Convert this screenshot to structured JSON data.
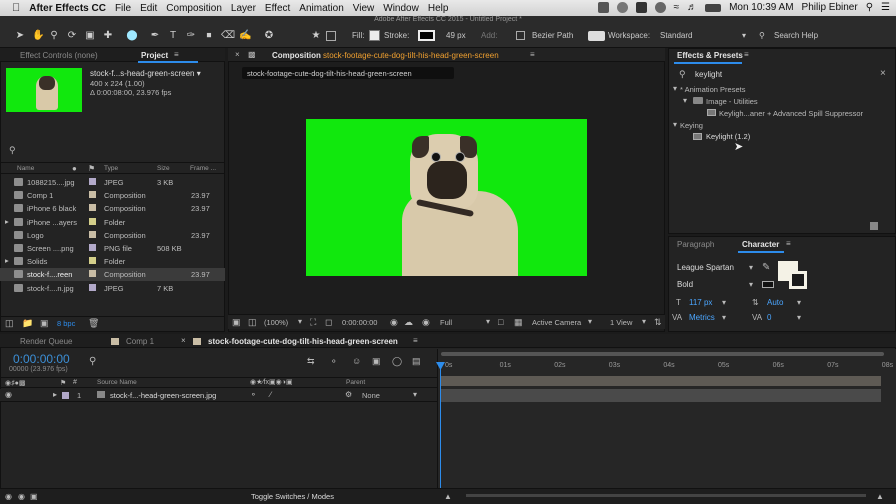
{
  "menubar": {
    "app_name": "After Effects CC",
    "items": [
      "File",
      "Edit",
      "Composition",
      "Layer",
      "Effect",
      "Animation",
      "View",
      "Window",
      "Help"
    ],
    "clock": "Mon 10:39 AM",
    "user": "Philip Ebiner"
  },
  "window_title": "Adobe After Effects CC 2015 - Untitled Project *",
  "toolbar": {
    "fill_label": "Fill:",
    "stroke_label": "Stroke:",
    "stroke_px": "49 px",
    "add_label": "Add:",
    "bezier_label": "Bezier Path",
    "workspace_label": "Workspace:",
    "workspace_value": "Standard",
    "search_help": "Search Help"
  },
  "project_panel": {
    "tab_effect_controls": "Effect Controls (none)",
    "tab_project": "Project",
    "selected_name": "stock-f...s-head-green-screen ▾",
    "selected_size": "400 x 224 (1.00)",
    "selected_duration": "Δ 0:00:08:00, 23.976 fps",
    "columns": {
      "name": "Name",
      "type": "Type",
      "size": "Size",
      "frame": "Frame ..."
    },
    "items": [
      {
        "name": "1088215....jpg",
        "type": "JPEG",
        "size": "3 KB",
        "frame": "",
        "color": "#b2a9c9"
      },
      {
        "name": "Comp 1",
        "type": "Composition",
        "size": "",
        "frame": "23.97",
        "color": "#c9bda5"
      },
      {
        "name": "iPhone 6 black",
        "type": "Composition",
        "size": "",
        "frame": "23.97",
        "color": "#c9bda5"
      },
      {
        "name": "iPhone ...ayers",
        "type": "Folder",
        "size": "",
        "frame": "",
        "color": "#d4cf8a"
      },
      {
        "name": "Logo",
        "type": "Composition",
        "size": "",
        "frame": "23.97",
        "color": "#c9bda5"
      },
      {
        "name": "Screen ....png",
        "type": "PNG file",
        "size": "508 KB",
        "frame": "",
        "color": "#b2a9c9"
      },
      {
        "name": "Solids",
        "type": "Folder",
        "size": "",
        "frame": "",
        "color": "#d4cf8a"
      },
      {
        "name": "stock-f....reen",
        "type": "Composition",
        "size": "",
        "frame": "23.97",
        "color": "#c9bda5"
      },
      {
        "name": "stock-f....n.jpg",
        "type": "JPEG",
        "size": "7 KB",
        "frame": "",
        "color": "#b2a9c9"
      }
    ],
    "bpc": "8 bpc"
  },
  "composition_panel": {
    "tab_label": "Composition",
    "comp_name": "stock-footage-cute-dog-tilt-his-head-green-screen",
    "crumb": "stock-footage-cute-dog-tilt-his-head-green-screen",
    "zoom": "(100%)",
    "timecode": "0:00:00:00",
    "resolution": "Full",
    "camera": "Active Camera",
    "view": "1 View"
  },
  "effects_panel": {
    "title": "Effects & Presets",
    "search_value": "keylight",
    "tree": [
      "* Animation Presets",
      "Image - Utilities",
      "Keyligh...aner + Advanced Spill Suppressor",
      "Keying",
      "Keylight (1.2)"
    ]
  },
  "character_panel": {
    "tab_paragraph": "Paragraph",
    "tab_character": "Character",
    "font": "League Spartan",
    "style": "Bold",
    "size": "117 px",
    "leading": "Auto",
    "kerning": "Metrics",
    "tracking": "0"
  },
  "timeline": {
    "tab_render": "Render Queue",
    "tab_comp1": "Comp 1",
    "tab_active": "stock-footage-cute-dog-tilt-his-head-green-screen",
    "timecode": "0:00:00:00",
    "frame_info": "00000 (23.976 fps)",
    "col_source": "Source Name",
    "col_parent": "Parent",
    "layer_index": "1",
    "layer_name": "stock-f...-head-green-screen.jpg",
    "layer_parent": "None",
    "ruler": [
      "0s",
      "01s",
      "02s",
      "03s",
      "04s",
      "05s",
      "06s",
      "07s",
      "08s"
    ],
    "toggle_label": "Toggle Switches / Modes"
  },
  "colors": {
    "green_screen": "#11e80d",
    "accent_blue": "#2d8ceb",
    "timecode": "#3c8fd6"
  }
}
